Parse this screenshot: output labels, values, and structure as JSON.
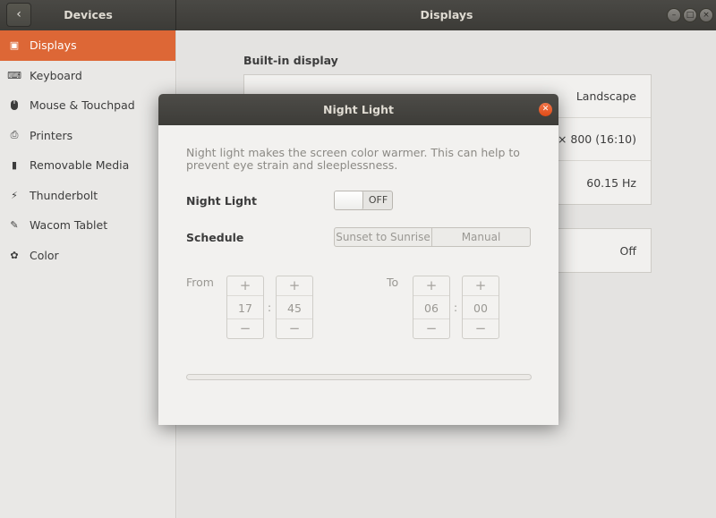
{
  "header": {
    "left_title": "Devices",
    "title": "Displays",
    "back_icon": "‹",
    "window_controls": [
      "minimize",
      "maximize",
      "close"
    ]
  },
  "sidebar": {
    "items": [
      {
        "label": "Displays",
        "icon": "display-icon",
        "glyph": "▣"
      },
      {
        "label": "Keyboard",
        "icon": "keyboard-icon",
        "glyph": "⌨"
      },
      {
        "label": "Mouse & Touchpad",
        "icon": "mouse-icon",
        "glyph": "🖱"
      },
      {
        "label": "Printers",
        "icon": "printer-icon",
        "glyph": "⎙"
      },
      {
        "label": "Removable Media",
        "icon": "usb-icon",
        "glyph": "▮"
      },
      {
        "label": "Thunderbolt",
        "icon": "thunderbolt-icon",
        "glyph": "⚡"
      },
      {
        "label": "Wacom Tablet",
        "icon": "tablet-icon",
        "glyph": "✎"
      },
      {
        "label": "Color",
        "icon": "color-icon",
        "glyph": "✿"
      }
    ],
    "active_index": 0,
    "accent_color": "#dd6736"
  },
  "main": {
    "section_title": "Built-in display",
    "display_rows": [
      "Landscape",
      "80 × 800 (16:10)",
      "60.15 Hz"
    ],
    "night_light_row": "Off"
  },
  "dialog": {
    "title": "Night Light",
    "description": "Night light makes the screen color warmer. This can help to prevent eye strain and sleeplessness.",
    "night_light_label": "Night Light",
    "switch_state": "OFF",
    "schedule_label": "Schedule",
    "schedule_options": [
      "Sunset to Sunrise",
      "Manual"
    ],
    "from_label": "From",
    "to_label": "To",
    "from_hour": "17",
    "from_minute": "45",
    "to_hour": "06",
    "to_minute": "00",
    "separator": ":",
    "plus": "+",
    "minus": "−",
    "close_glyph": "✕"
  }
}
